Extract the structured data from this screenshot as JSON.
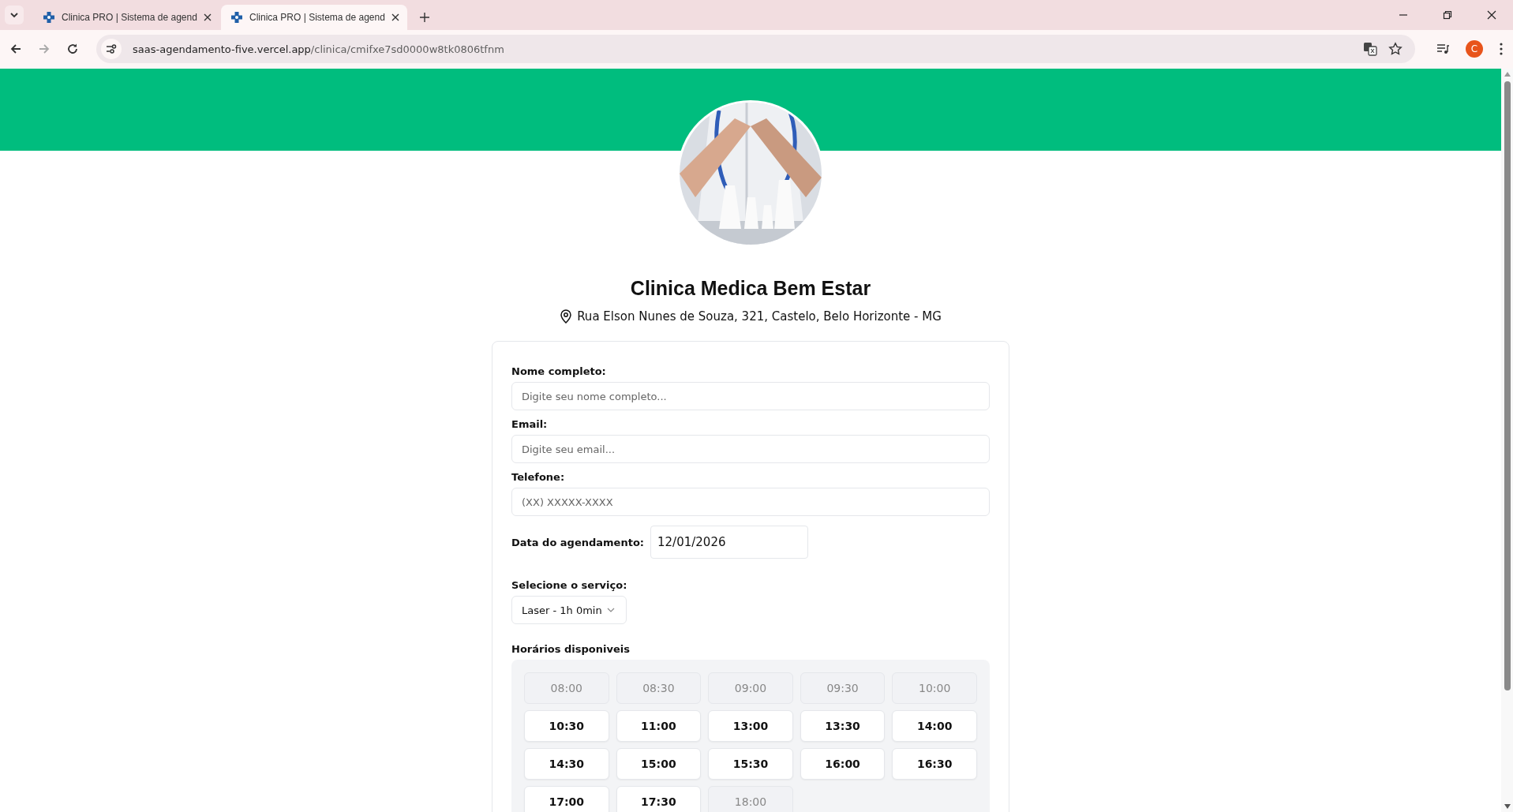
{
  "browser": {
    "tabs": [
      {
        "title": "Clinica PRO | Sistema de agend",
        "selected": false
      },
      {
        "title": "Clinica PRO | Sistema de agend",
        "selected": true
      }
    ],
    "url": {
      "host": "saas-agendamento-five.vercel.app",
      "path": "/clinica/cmifxe7sd0000w8tk0806tfnm"
    },
    "profile": "C"
  },
  "clinic": {
    "name": "Clinica Medica Bem Estar",
    "address": "Rua Elson Nunes de Souza, 321, Castelo, Belo Horizonte - MG"
  },
  "form": {
    "fields": [
      {
        "label": "Nome completo:",
        "placeholder": "Digite seu nome completo..."
      },
      {
        "label": "Email:",
        "placeholder": "Digite seu email..."
      },
      {
        "label": "Telefone:",
        "placeholder": "(XX) XXXXX-XXXX"
      }
    ],
    "date": {
      "label": "Data do agendamento:",
      "value": "12/01/2026"
    },
    "service": {
      "label": "Selecione o serviço:",
      "value": "Laser - 1h 0min"
    },
    "slots_title": "Horários disponiveis",
    "slots": [
      {
        "time": "08:00",
        "disabled": true
      },
      {
        "time": "08:30",
        "disabled": true
      },
      {
        "time": "09:00",
        "disabled": true
      },
      {
        "time": "09:30",
        "disabled": true
      },
      {
        "time": "10:00",
        "disabled": true
      },
      {
        "time": "10:30",
        "disabled": false
      },
      {
        "time": "11:00",
        "disabled": false
      },
      {
        "time": "13:00",
        "disabled": false
      },
      {
        "time": "13:30",
        "disabled": false
      },
      {
        "time": "14:00",
        "disabled": false
      },
      {
        "time": "14:30",
        "disabled": false
      },
      {
        "time": "15:00",
        "disabled": false
      },
      {
        "time": "15:30",
        "disabled": false
      },
      {
        "time": "16:00",
        "disabled": false
      },
      {
        "time": "16:30",
        "disabled": false
      },
      {
        "time": "17:00",
        "disabled": false
      },
      {
        "time": "17:30",
        "disabled": false
      },
      {
        "time": "18:00",
        "disabled": true
      }
    ]
  }
}
